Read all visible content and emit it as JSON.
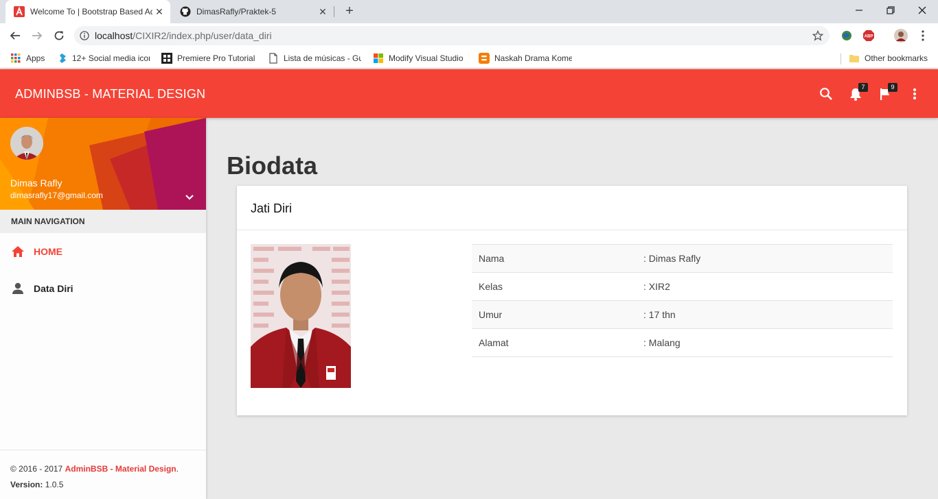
{
  "browser": {
    "tabs": [
      {
        "title": "Welcome To | Bootstrap Based Admin",
        "active": true
      },
      {
        "title": "DimasRafly/Praktek-5",
        "active": false
      }
    ],
    "url_host": "localhost",
    "url_path": "/CIXIR2/index.php/user/data_diri",
    "bookmarks": [
      {
        "label": "Apps",
        "icon": "apps-grid-icon"
      },
      {
        "label": "12+ Social media icon",
        "icon": "social-icon"
      },
      {
        "label": "Premiere Pro Tutorial",
        "icon": "video-icon"
      },
      {
        "label": "Lista de músicas - Gu",
        "icon": "page-icon"
      },
      {
        "label": "Modify Visual Studio",
        "icon": "windows-icon"
      },
      {
        "label": "Naskah Drama Kome",
        "icon": "blogger-icon"
      }
    ],
    "other_bookmarks": "Other bookmarks"
  },
  "header": {
    "brand": "ADMINBSB - MATERIAL DESIGN",
    "notification_count": "7",
    "task_count": "9",
    "accent_color": "#f44336"
  },
  "sidebar": {
    "user_name": "Dimas Rafly",
    "user_email": "dimasrafly17@gmail.com",
    "nav_header": "MAIN NAVIGATION",
    "items": [
      {
        "label": "HOME",
        "icon": "home-icon",
        "active": true
      },
      {
        "label": "Data Diri",
        "icon": "person-icon",
        "active": false
      }
    ],
    "footer": {
      "copyright": "© 2016 - 2017 ",
      "brand_link": "AdminBSB - Material Design",
      "period": ".",
      "version_label": "Version:",
      "version_value": " 1.0.5"
    }
  },
  "main": {
    "page_title": "Biodata",
    "card_title": "Jati Diri",
    "biodata": [
      {
        "key": "Nama",
        "value": ": Dimas Rafly"
      },
      {
        "key": "Kelas",
        "value": ": XIR2"
      },
      {
        "key": "Umur",
        "value": ": 17 thn"
      },
      {
        "key": "Alamat",
        "value": ": Malang"
      }
    ]
  }
}
